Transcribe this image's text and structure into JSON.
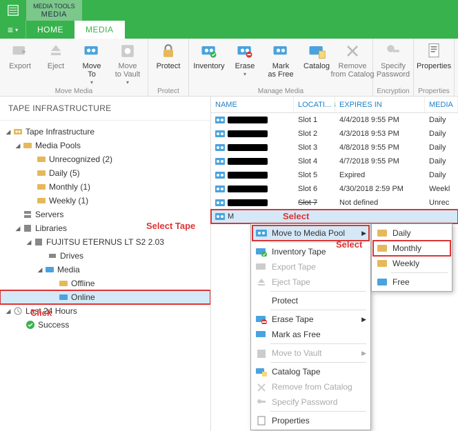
{
  "title_tool": {
    "sup": "MEDIA TOOLS",
    "main": "MEDIA"
  },
  "tabs": {
    "home": "HOME",
    "media": "MEDIA"
  },
  "ribbon": {
    "groups": {
      "move_media": {
        "label": "Move Media",
        "export": "Export",
        "eject": "Eject",
        "move_to": "Move\nTo",
        "move_vault": "Move\nto Vault"
      },
      "protect": {
        "label": "Protect",
        "protect": "Protect"
      },
      "manage_media": {
        "label": "Manage Media",
        "inventory": "Inventory",
        "erase": "Erase",
        "mark_free": "Mark\nas Free",
        "catalog": "Catalog",
        "remove_catalog": "Remove\nfrom Catalog"
      },
      "encryption": {
        "label": "Encryption",
        "specify": "Specify\nPassword"
      },
      "properties": {
        "label": "Properties",
        "props": "Properties"
      }
    }
  },
  "sidebar": {
    "title": "TAPE INFRASTRUCTURE",
    "tree": {
      "root": "Tape Infrastructure",
      "media_pools": "Media Pools",
      "unrecognized": "Unrecognized (2)",
      "daily": "Daily (5)",
      "monthly": "Monthly (1)",
      "weekly": "Weekly (1)",
      "servers": "Servers",
      "libraries": "Libraries",
      "library_name": "FUJITSU ETERNUS LT S2 2.03",
      "drives": "Drives",
      "media": "Media",
      "offline": "Offline",
      "online": "Online",
      "last24": "Last 24 Hours",
      "success": "Success"
    }
  },
  "columns": {
    "name": "NAME",
    "location": "LOCATI...",
    "expires": "EXPIRES IN",
    "media": "MEDIA"
  },
  "rows": [
    {
      "loc": "Slot 1",
      "exp": "4/4/2018 9:55 PM",
      "med": "Daily"
    },
    {
      "loc": "Slot 2",
      "exp": "4/3/2018 9:53 PM",
      "med": "Daily"
    },
    {
      "loc": "Slot 3",
      "exp": "4/8/2018 9:55 PM",
      "med": "Daily"
    },
    {
      "loc": "Slot 4",
      "exp": "4/7/2018 9:55 PM",
      "med": "Daily"
    },
    {
      "loc": "Slot 5",
      "exp": "Expired",
      "med": "Daily"
    },
    {
      "loc": "Slot 6",
      "exp": "4/30/2018 2:59 PM",
      "med": "Weekl"
    },
    {
      "loc": "Slot 7",
      "exp": "Not defined",
      "med": "Unrec"
    }
  ],
  "selected_row_name": "M",
  "ctx": {
    "move_pool": "Move to Media Pool",
    "inventory": "Inventory Tape",
    "export": "Export Tape",
    "eject": "Eject Tape",
    "protect": "Protect",
    "erase": "Erase Tape",
    "mark_free": "Mark as Free",
    "move_vault": "Move to Vault",
    "catalog": "Catalog Tape",
    "remove_catalog": "Remove from Catalog",
    "specify_pw": "Specify Password",
    "props": "Properties"
  },
  "submenu": {
    "daily": "Daily",
    "monthly": "Monthly",
    "weekly": "Weekly",
    "free": "Free"
  },
  "annotations": {
    "select_tape": "Select Tape",
    "select1": "Select",
    "select2": "Select",
    "click": "Click"
  }
}
